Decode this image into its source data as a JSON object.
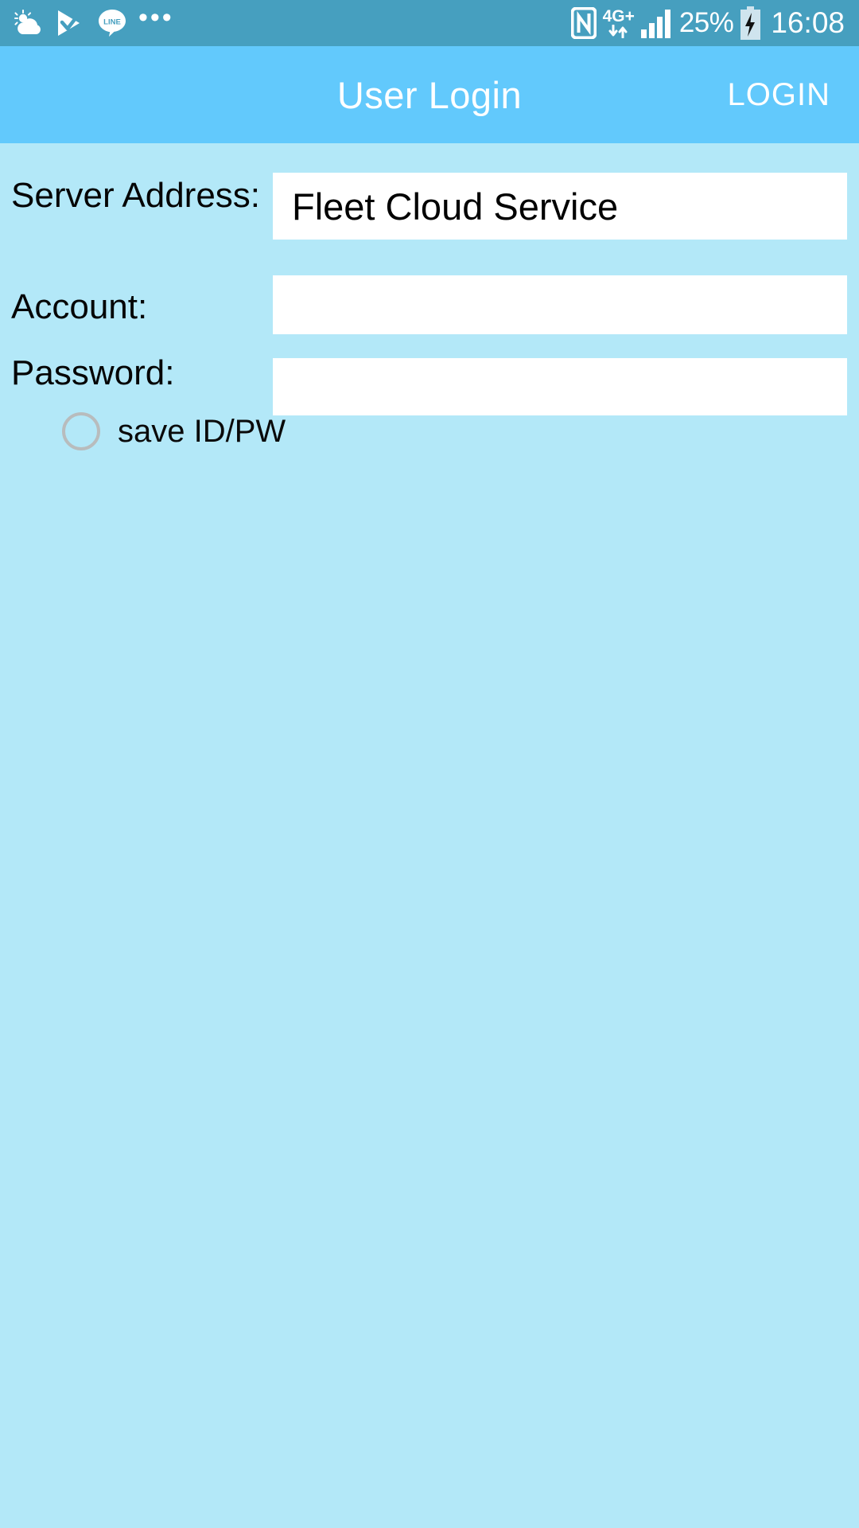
{
  "status_bar": {
    "background": "#469fbf",
    "left_icons": [
      {
        "name": "weather-icon",
        "label": "weather"
      },
      {
        "name": "play-store-check-icon",
        "label": "play-store"
      },
      {
        "name": "line-app-icon",
        "label": "LINE"
      },
      {
        "name": "more-notifications-icon",
        "label": "…"
      }
    ],
    "overflow": "•••",
    "nfc_icon": "nfc-icon",
    "network_type": "4G+",
    "network_arrows": "↓↑",
    "signal_icon": "signal-bars-icon",
    "battery_percent": "25%",
    "battery_icon": "battery-charging-icon",
    "clock": "16:08"
  },
  "app_bar": {
    "background": "#62c9fc",
    "title": "User Login",
    "action_label": "LOGIN"
  },
  "form": {
    "background": "#b3e8f8",
    "fields": [
      {
        "name": "server-address",
        "label": "Server Address:",
        "value": "Fleet Cloud Service",
        "placeholder": ""
      },
      {
        "name": "account",
        "label": "Account:",
        "value": "",
        "placeholder": ""
      },
      {
        "name": "password",
        "label": "Password:",
        "value": "",
        "placeholder": ""
      }
    ],
    "save_checkbox": {
      "label": "save ID/PW",
      "checked": false
    }
  }
}
